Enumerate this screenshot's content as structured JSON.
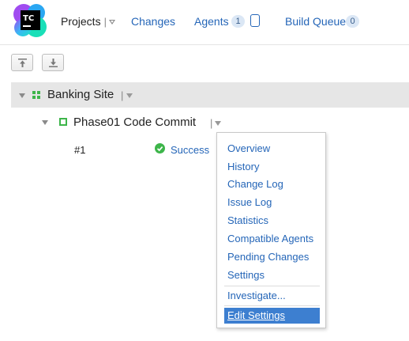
{
  "header": {
    "logo_text": "TC",
    "projects_label": "Projects",
    "changes_label": "Changes",
    "agents_label": "Agents",
    "agents_count": "1",
    "build_queue_label": "Build Queue",
    "build_queue_count": "0"
  },
  "toolbar": {
    "collapse_icon": "collapse-all-icon",
    "expand_icon": "expand-all-icon"
  },
  "project": {
    "name": "Banking Site",
    "build_config": {
      "name": "Phase01 Code Commit",
      "build_number": "#1",
      "status": "Success"
    }
  },
  "menu": {
    "items": [
      "Overview",
      "History",
      "Change Log",
      "Issue Log",
      "Statistics",
      "Compatible Agents",
      "Pending Changes",
      "Settings"
    ],
    "investigate_label": "Investigate...",
    "edit_settings_label": "Edit Settings"
  },
  "colors": {
    "link": "#2566b8",
    "success": "#3db54a",
    "selected": "#3d7fd0",
    "project_row_bg": "#e6e6e6"
  }
}
